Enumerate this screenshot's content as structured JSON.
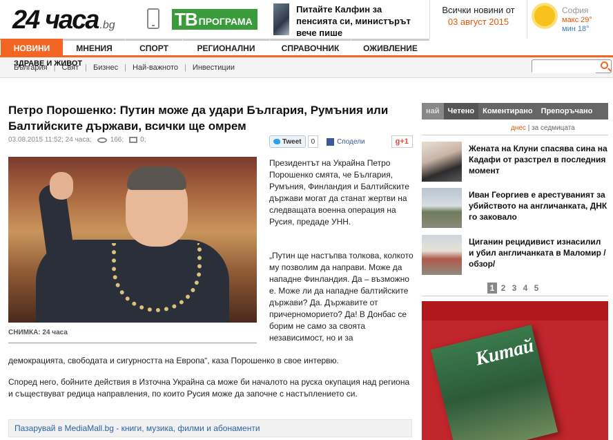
{
  "header": {
    "logo_main": "24 часа",
    "logo_domain": ".bg",
    "tv_big": "ТВ",
    "tv_small": "ПРОГРАМА",
    "promo_text": "Питайте Калфин за пенсията си, министърът вече пише",
    "news_label": "Всички новини от",
    "news_date": "03 август 2015",
    "weather": {
      "city": "София",
      "max": "макс 29°",
      "min": "мин 18°",
      "icon": "sun-icon"
    }
  },
  "nav": {
    "items": [
      {
        "label": "НОВИНИ",
        "active": true
      },
      {
        "label": "МНЕНИЯ"
      },
      {
        "label": "СПОРТ"
      },
      {
        "label": "РЕГИОНАЛНИ"
      },
      {
        "label": "СПРАВОЧНИК"
      },
      {
        "label": "ОЖИВЛЕНИЕ"
      }
    ],
    "accent": "#f26522"
  },
  "subnav": {
    "links": [
      "България",
      "Свят",
      "Бизнес",
      "Най-важното",
      "Инвестиции"
    ],
    "health": "ЗДРАВЕ И ЖИВОТ"
  },
  "article": {
    "title": "Петро Порошенко: Путин може да удари България, Румъния или Балтийските държави, всички ще омрем",
    "datetime": "03.08.2015 11:52;",
    "source": "24 часа;",
    "views": "166;",
    "comments": "0;",
    "share": {
      "tweet": "Tweet",
      "tweet_count": "0",
      "fb": "Сподели",
      "gplus": "g+1"
    },
    "photo_caption": "СНИМКА: 24 часа",
    "p1": "Президентът на Украйна Петро Порошенко смята, че България, Румъния, Финландия и Балтийските държави могат да станат жертви на следващата военна операция на Русия, предаде УНН.",
    "p2": "„Путин ще настъпва толкова, колкото му позволим да направи. Може да нападне Финландия. Да – възможно е. Може ли да нападне балтийските държави? Да. Държавите от причерноморието? Да! В Донбас се борим не само за своята независимост, но и за",
    "p2_cont": "демокрацията, свободата и сигурността на Европа“, каза Порошенко в свое интервю.",
    "p3": "Според него, бойните действия в Източна Украйна са може би началото на руска окупация над региона и съществуват редица направления, по които Русия може да започне с настъплението си.",
    "mall": "Пазарувай в MediaMall.bg - книги, музика, филми и абонаменти"
  },
  "sidebar": {
    "tabs": [
      "най",
      "Четено",
      "Коментирано",
      "Препоръчано"
    ],
    "period_today": "днес",
    "period_sep": " | ",
    "period_week": "за седмицата",
    "items": [
      {
        "title": "Жената на Клуни спасява сина на Кадафи от разстрел в последния момент"
      },
      {
        "title": "Иван Георгиев е арестуваният за убийството на англичанката, ДНК го заковало"
      },
      {
        "title": "Циганин рецидивист изнасилил и убил англичанката в Маломир / обзор/"
      }
    ],
    "pages": [
      "1",
      "2",
      "3",
      "4",
      "5"
    ],
    "ad_mag_title": "Китай"
  }
}
